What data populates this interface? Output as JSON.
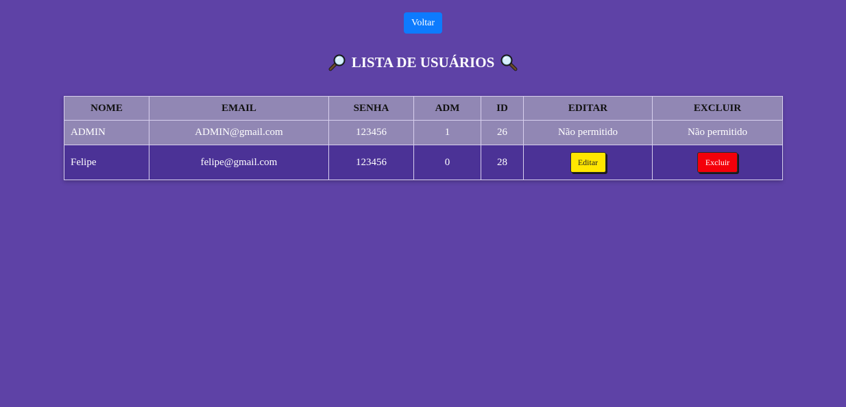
{
  "header": {
    "back_label": "Voltar",
    "title": "LISTA DE USUÁRIOS",
    "title_icon_left": "magnifier-left-icon",
    "title_icon_right": "magnifier-right-icon"
  },
  "table": {
    "columns": [
      "NOME",
      "EMAIL",
      "SENHA",
      "ADM",
      "ID",
      "EDITAR",
      "EXCLUIR"
    ],
    "rows": [
      {
        "nome": "ADMIN",
        "email": "ADMIN@gmail.com",
        "senha": "123456",
        "adm": "1",
        "id": "26",
        "editar": "Não permitido",
        "excluir": "Não permitido"
      },
      {
        "nome": "Felipe",
        "email": "felipe@gmail.com",
        "senha": "123456",
        "adm": "0",
        "id": "28",
        "editar": "Editar",
        "excluir": "Excluir"
      }
    ]
  },
  "colors": {
    "background": "#5e42a6",
    "header_row": "#9187b4",
    "user_row": "#4b3296",
    "back_button": "#0d7bfe",
    "edit_button": "#ffe600",
    "delete_button": "#f4000a"
  }
}
